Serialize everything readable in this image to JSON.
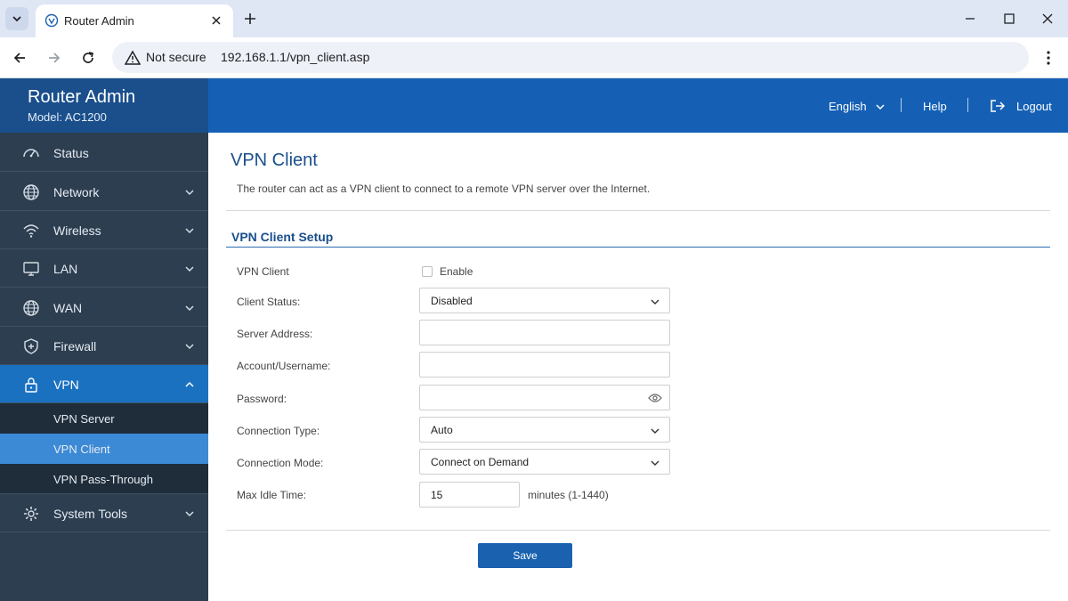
{
  "browser": {
    "tab_title": "Router Admin",
    "security_label": "Not secure",
    "url": "192.168.1.1/vpn_client.asp"
  },
  "header": {
    "title": "Router Admin",
    "model": "Model: AC1200",
    "language": "English",
    "help": "Help",
    "logout": "Logout"
  },
  "sidebar": {
    "items": [
      {
        "label": "Status",
        "icon": "speedometer-icon"
      },
      {
        "label": "Network",
        "icon": "globe-icon"
      },
      {
        "label": "Wireless",
        "icon": "wifi-icon"
      },
      {
        "label": "LAN",
        "icon": "monitor-icon"
      },
      {
        "label": "WAN",
        "icon": "globe-icon"
      },
      {
        "label": "Firewall",
        "icon": "shield-icon"
      },
      {
        "label": "VPN",
        "icon": "lock-icon"
      },
      {
        "label": "System Tools",
        "icon": "gear-icon"
      }
    ],
    "vpn_sub": [
      "VPN Server",
      "VPN Client",
      "VPN Pass-Through"
    ]
  },
  "main": {
    "title": "VPN Client",
    "description": "The router can act as a VPN client to connect to a remote VPN server over the Internet.",
    "section_title": "VPN Client Setup",
    "form": {
      "vpn_client_label": "VPN Client",
      "enable_label": "Enable",
      "enable_checked": false,
      "client_status_label": "Client Status:",
      "client_status_value": "Disabled",
      "server_address_label": "Server Address:",
      "server_address_value": "",
      "account_label": "Account/Username:",
      "account_value": "",
      "password_label": "Password:",
      "password_value": "",
      "connection_type_label": "Connection Type:",
      "connection_type_value": "Auto",
      "connection_mode_label": "Connection Mode:",
      "connection_mode_value": "Connect on Demand",
      "max_idle_label": "Max Idle Time:",
      "max_idle_value": "15",
      "max_idle_unit": "minutes (1-1440)"
    },
    "save_label": "Save"
  },
  "colors": {
    "header_blue": "#1560b5",
    "brand_blue": "#1a4f8c",
    "sidebar_dark": "#2c3e50",
    "active_item": "#1a71c0",
    "active_sub": "#3c8ad6",
    "save_button": "#1a62b0"
  }
}
